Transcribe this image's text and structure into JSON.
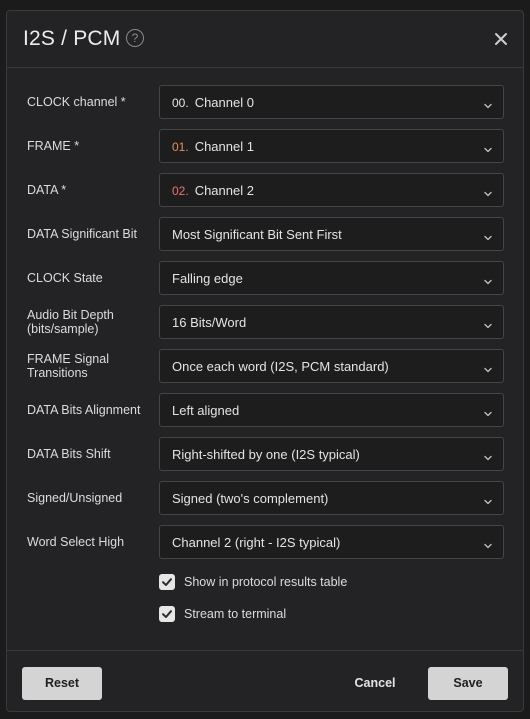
{
  "dialog": {
    "title": "I2S / PCM",
    "help_symbol": "?",
    "icons": {
      "help": "help-circle-icon",
      "close": "close-icon",
      "chevron": "chevron-down-icon",
      "check": "check-icon"
    }
  },
  "fields": [
    {
      "label": "CLOCK channel *",
      "prefix": "00.",
      "prefix_color": "#e4e4e4",
      "value": "Channel 0"
    },
    {
      "label": "FRAME *",
      "prefix": "01.",
      "prefix_color": "#e0905a",
      "value": "Channel 1"
    },
    {
      "label": "DATA *",
      "prefix": "02.",
      "prefix_color": "#f07070",
      "value": "Channel 2"
    },
    {
      "label": "DATA Significant Bit",
      "value": "Most Significant Bit Sent First"
    },
    {
      "label": "CLOCK State",
      "value": "Falling edge"
    },
    {
      "label": "Audio Bit Depth (bits/sample)",
      "value": "16 Bits/Word"
    },
    {
      "label": "FRAME Signal Transitions",
      "value": "Once each word (I2S, PCM standard)"
    },
    {
      "label": "DATA Bits Alignment",
      "value": "Left aligned"
    },
    {
      "label": "DATA Bits Shift",
      "value": "Right-shifted by one (I2S typical)"
    },
    {
      "label": "Signed/Unsigned",
      "value": "Signed (two's complement)"
    },
    {
      "label": "Word Select High",
      "value": "Channel 2 (right - I2S typical)"
    }
  ],
  "options": [
    {
      "label": "Show in protocol results table",
      "checked": true
    },
    {
      "label": "Stream to terminal",
      "checked": true
    }
  ],
  "footer": {
    "reset_label": "Reset",
    "cancel_label": "Cancel",
    "save_label": "Save"
  }
}
